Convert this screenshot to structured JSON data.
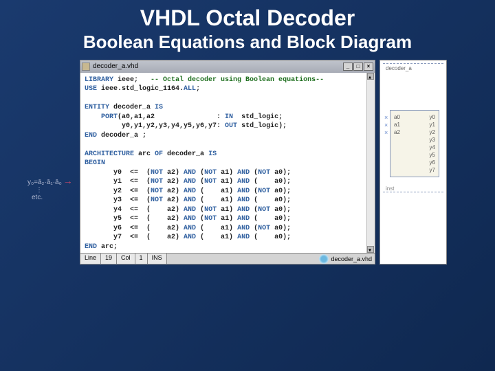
{
  "title": "VHDL Octal Decoder",
  "subtitle": "Boolean Equations and Block Diagram",
  "window": {
    "filename": "decoder_a.vhd",
    "minimize": "_",
    "maximize": "□",
    "close": "×"
  },
  "annotation": {
    "eq": "y₀=ā₂·ā₁·ā₀",
    "dots": "⋮",
    "etc": "etc."
  },
  "code": {
    "l1_kw1": "LIBRARY",
    "l1_id": " ieee;   ",
    "l1_cmt": "-- Octal decoder using Boolean equations--",
    "l2_kw1": "USE",
    "l2_id": " ieee.std_logic_1164.",
    "l2_kw2": "ALL",
    "l2_sc": ";",
    "l4_kw1": "ENTITY",
    "l4_id": " decoder_a ",
    "l4_kw2": "IS",
    "l5_kw1": "    PORT",
    "l5_p1": "(a0,a1,a2               : ",
    "l5_kw2": "IN",
    "l5_t1": "  std_logic;",
    "l6_p1": "         y0,y1,y2,y3,y4,y5,y6,y7: ",
    "l6_kw1": "OUT",
    "l6_t1": " std_logic);",
    "l7_kw1": "END",
    "l7_id": " decoder_a ;",
    "l9_kw1": "ARCHITECTURE",
    "l9_id1": " arc ",
    "l9_kw2": "OF",
    "l9_id2": " decoder_a ",
    "l9_kw3": "IS",
    "l10_kw1": "BEGIN",
    "eq0": "       y0  <=  (",
    "n0a": "NOT",
    "eq0b": " a2) ",
    "a0a": "AND",
    "eq0c": " (",
    "n0b": "NOT",
    "eq0d": " a1) ",
    "a0b": "AND",
    "eq0e": " (",
    "n0c": "NOT",
    "eq0f": " a0);",
    "eq1": "       y1  <=  (",
    "n1a": "NOT",
    "eq1b": " a2) ",
    "a1a": "AND",
    "eq1c": " (",
    "n1b": "NOT",
    "eq1d": " a1) ",
    "a1b": "AND",
    "eq1e": " (    a0);",
    "eq2": "       y2  <=  (",
    "n2a": "NOT",
    "eq2b": " a2) ",
    "a2a": "AND",
    "eq2c": " (    a1) ",
    "a2b": "AND",
    "eq2e": " (",
    "n2c": "NOT",
    "eq2f": " a0);",
    "eq3": "       y3  <=  (",
    "n3a": "NOT",
    "eq3b": " a2) ",
    "a3a": "AND",
    "eq3c": " (    a1) ",
    "a3b": "AND",
    "eq3e": " (    a0);",
    "eq4": "       y4  <=  (    a2) ",
    "a4a": "AND",
    "eq4c": " (",
    "n4b": "NOT",
    "eq4d": " a1) ",
    "a4b": "AND",
    "eq4e": " (",
    "n4c": "NOT",
    "eq4f": " a0);",
    "eq5": "       y5  <=  (    a2) ",
    "a5a": "AND",
    "eq5c": " (",
    "n5b": "NOT",
    "eq5d": " a1) ",
    "a5b": "AND",
    "eq5e": " (    a0);",
    "eq6": "       y6  <=  (    a2) ",
    "a6a": "AND",
    "eq6c": " (    a1) ",
    "a6b": "AND",
    "eq6e": " (",
    "n6c": "NOT",
    "eq6f": " a0);",
    "eq7": "       y7  <=  (    a2) ",
    "a7a": "AND",
    "eq7c": " (    a1) ",
    "a7b": "AND",
    "eq7e": " (    a0);",
    "l19_kw1": "END",
    "l19_id": " arc;"
  },
  "status": {
    "line_lbl": "Line",
    "line_val": "19",
    "col_lbl": "Col",
    "col_val": "1",
    "ins": "INS",
    "file": "decoder_a.vhd"
  },
  "diagram": {
    "title": "decoder_a",
    "inst": "inst",
    "inputs": [
      "a0",
      "a1",
      "a2"
    ],
    "outputs": [
      "y0",
      "y1",
      "y2",
      "y3",
      "y4",
      "y5",
      "y6",
      "y7"
    ]
  }
}
